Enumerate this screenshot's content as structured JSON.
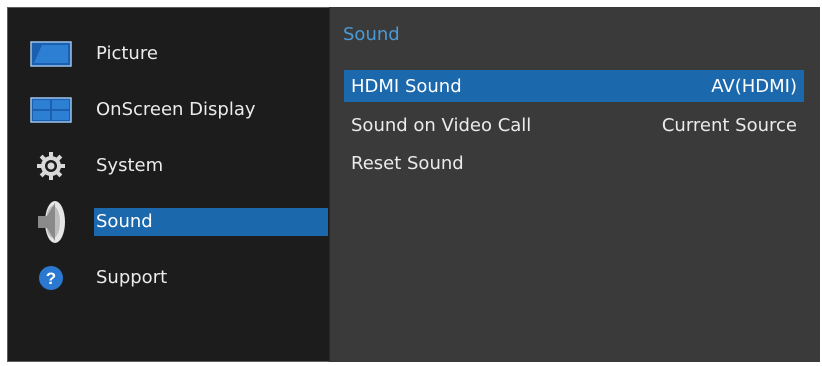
{
  "left_menu": {
    "items": [
      {
        "label": "Picture",
        "icon": "picture-icon"
      },
      {
        "label": "OnScreen Display",
        "icon": "onscreen-display-icon"
      },
      {
        "label": "System",
        "icon": "gear-icon"
      },
      {
        "label": "Sound",
        "icon": "speaker-icon",
        "selected": true
      },
      {
        "label": "Support",
        "icon": "help-icon"
      }
    ]
  },
  "panel": {
    "title": "Sound",
    "items": [
      {
        "label": "HDMI Sound",
        "value": "AV(HDMI)",
        "selected": true
      },
      {
        "label": "Sound on Video Call",
        "value": "Current Source"
      },
      {
        "label": "Reset Sound",
        "value": ""
      }
    ]
  },
  "colors": {
    "highlight": "#1b68ad",
    "panel_title": "#4a9ad8",
    "left_bg": "#1c1c1c",
    "right_bg": "#3a3a3a"
  }
}
